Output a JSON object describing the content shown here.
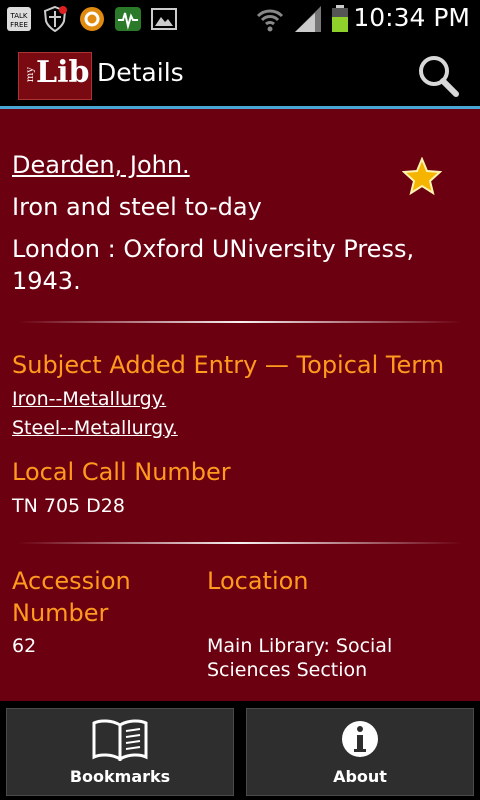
{
  "status_bar": {
    "time": "10:34 PM",
    "icons": [
      "talk-free-icon",
      "shield-icon",
      "circle-app-icon",
      "activity-icon",
      "gallery-icon",
      "wifi-icon",
      "signal-icon",
      "battery-icon"
    ]
  },
  "action_bar": {
    "logo_my": "my",
    "logo_lib": "Lib",
    "title": "Details",
    "search_icon": "search-icon",
    "accent_color": "#4aa6d5"
  },
  "record": {
    "author": "Dearden, John.",
    "title": "Iron and steel to-day",
    "publisher": "London : Oxford UNiversity Press, 1943.",
    "bookmarked": true
  },
  "subject": {
    "heading": "Subject Added Entry — Topical Term",
    "terms": [
      "Iron--Metallurgy.",
      "Steel--Metallurgy."
    ]
  },
  "call_number": {
    "heading": "Local Call Number",
    "value": "TN 705 D28"
  },
  "holdings": {
    "accession_heading": "Accession Number",
    "accession_value": "62",
    "location_heading": "Location",
    "location_value": "Main Library: Social Sciences Section"
  },
  "bottom_tabs": [
    {
      "label": "Bookmarks",
      "icon": "book-icon"
    },
    {
      "label": "About",
      "icon": "info-icon"
    }
  ],
  "colors": {
    "background": "#6b0010",
    "heading": "#ff9a1f",
    "star": "#f5b400"
  }
}
